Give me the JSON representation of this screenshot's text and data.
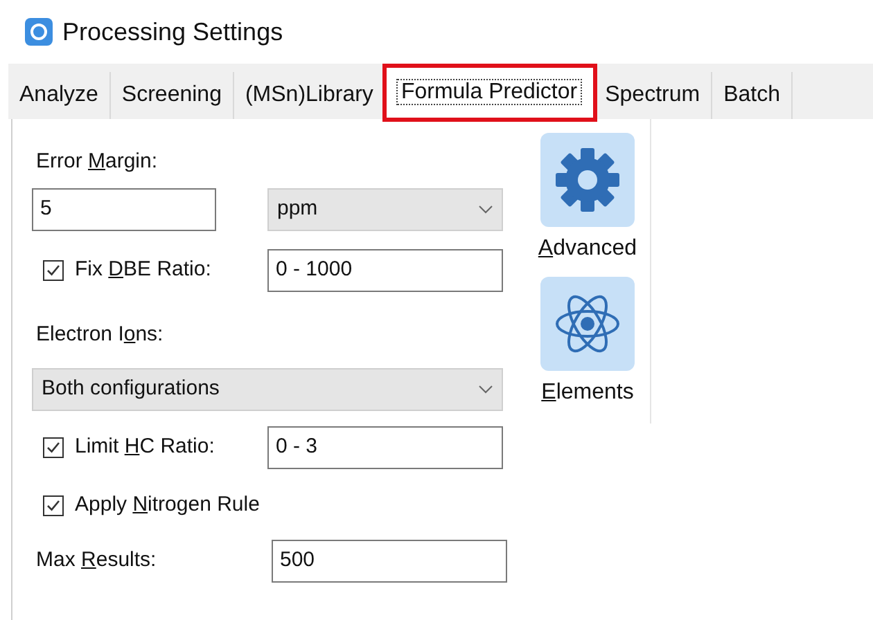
{
  "window": {
    "title": "Processing Settings"
  },
  "tabs": [
    {
      "label": "Analyze",
      "selected": false,
      "highlighted": false
    },
    {
      "label": "Screening",
      "selected": false,
      "highlighted": false
    },
    {
      "label": "(MSn)Library",
      "selected": false,
      "highlighted": false
    },
    {
      "label": "Formula Predictor",
      "selected": true,
      "highlighted": true
    },
    {
      "label": "Spectrum",
      "selected": false,
      "highlighted": false
    },
    {
      "label": "Batch",
      "selected": false,
      "highlighted": false
    }
  ],
  "error_margin": {
    "label": {
      "pre": "Error ",
      "key": "M",
      "post": "argin:"
    },
    "value": "5",
    "unit": "ppm"
  },
  "fix_dbe": {
    "checked": true,
    "label": {
      "pre": "Fix ",
      "key": "D",
      "post": "BE Ratio:"
    },
    "value": "0 - 1000"
  },
  "electron_ions": {
    "label": {
      "pre": "Electron I",
      "key": "o",
      "post": "ns:"
    },
    "value": "Both configurations"
  },
  "limit_hc": {
    "checked": true,
    "label": {
      "pre": "Limit ",
      "key": "H",
      "post": "C Ratio:"
    },
    "value": "0 - 3"
  },
  "nitrogen_rule": {
    "checked": true,
    "label": {
      "pre": "Apply ",
      "key": "N",
      "post": "itrogen Rule"
    }
  },
  "max_results": {
    "label": {
      "pre": "Max ",
      "key": "R",
      "post": "esults:"
    },
    "value": "500"
  },
  "side_buttons": [
    {
      "kind": "gear",
      "label": {
        "key": "A",
        "post": "dvanced"
      }
    },
    {
      "kind": "atom",
      "label": {
        "key": "E",
        "post": "lements"
      }
    }
  ]
}
